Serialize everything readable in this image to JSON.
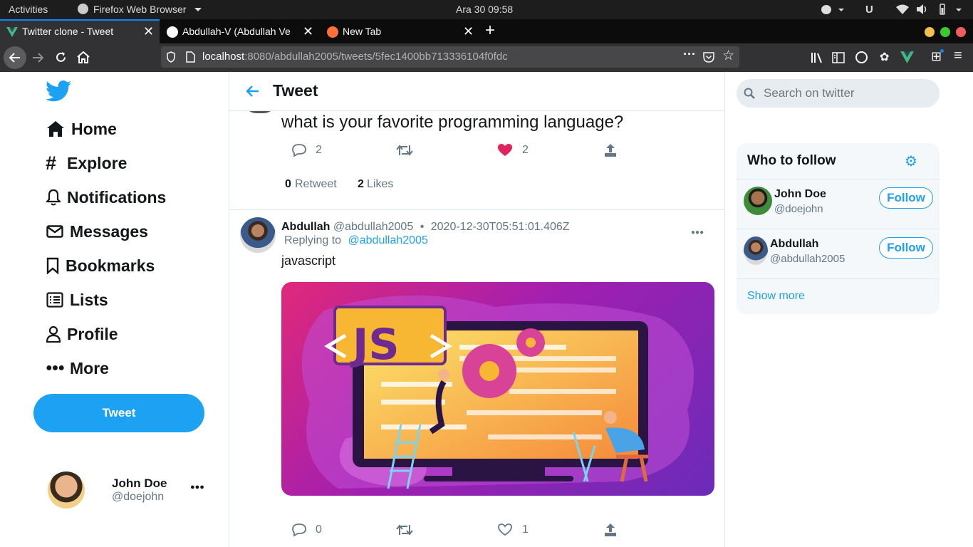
{
  "system": {
    "activities": "Activities",
    "app_name": "Firefox Web Browser",
    "clock": "Ara 30  09:58"
  },
  "browser": {
    "tabs": [
      {
        "title": "Twitter clone - Tweet",
        "active": true
      },
      {
        "title": "Abdullah-V (Abdullah Ve",
        "active": false
      },
      {
        "title": "New Tab",
        "active": false
      }
    ],
    "url_host": "localhost",
    "url_rest": ":8080/abdullah2005/tweets/5fec1400bb713336104f0fdc"
  },
  "sidebar": {
    "items": [
      {
        "label": "Home",
        "icon": "home-icon"
      },
      {
        "label": "Explore",
        "icon": "hashtag-icon"
      },
      {
        "label": "Notifications",
        "icon": "bell-icon"
      },
      {
        "label": "Messages",
        "icon": "envelope-icon"
      },
      {
        "label": "Bookmarks",
        "icon": "bookmark-icon"
      },
      {
        "label": "Lists",
        "icon": "list-icon"
      },
      {
        "label": "Profile",
        "icon": "user-icon"
      },
      {
        "label": "More",
        "icon": "more-icon"
      }
    ],
    "tweet_button": "Tweet",
    "account": {
      "name": "John Doe",
      "handle": "@doejohn"
    }
  },
  "header": {
    "title": "Tweet"
  },
  "main_tweet": {
    "text": "what is your favorite programming language?",
    "replies": "2",
    "likes": "2",
    "retweet_count": "0",
    "retweet_label": "Retweet",
    "likes_count": "2",
    "likes_label": "Likes",
    "liked_color": "#e0245e"
  },
  "reply": {
    "name": "Abdullah",
    "handle": "@abdullah2005",
    "separator": "•",
    "timestamp": "2020-12-30T05:51:01.406Z",
    "replying_to_label": "Replying to",
    "replying_to_handle": "@abdullah2005",
    "text": "javascript",
    "image_text": "JS",
    "replies": "0",
    "likes": "1"
  },
  "right": {
    "search_placeholder": "Search on twitter",
    "who_to_follow_title": "Who to follow",
    "suggestions": [
      {
        "name": "John Doe",
        "handle": "@doejohn",
        "button": "Follow"
      },
      {
        "name": "Abdullah",
        "handle": "@abdullah2005",
        "button": "Follow"
      }
    ],
    "show_more": "Show more"
  },
  "colors": {
    "accent": "#1da1f2",
    "like": "#e0245e"
  }
}
